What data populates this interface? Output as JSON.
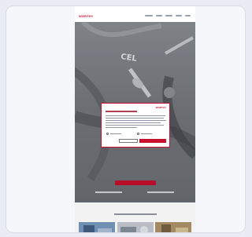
{
  "site": {
    "logo_text": "WORTHY",
    "brand_color": "#c8102e"
  },
  "hero": {
    "background_label": "CEL",
    "title": "",
    "cta_color": "#c8102e"
  },
  "modal": {
    "logo_text": "WORTHY",
    "accent_color": "#c8102e"
  },
  "icons": {
    "close": "close-icon"
  }
}
